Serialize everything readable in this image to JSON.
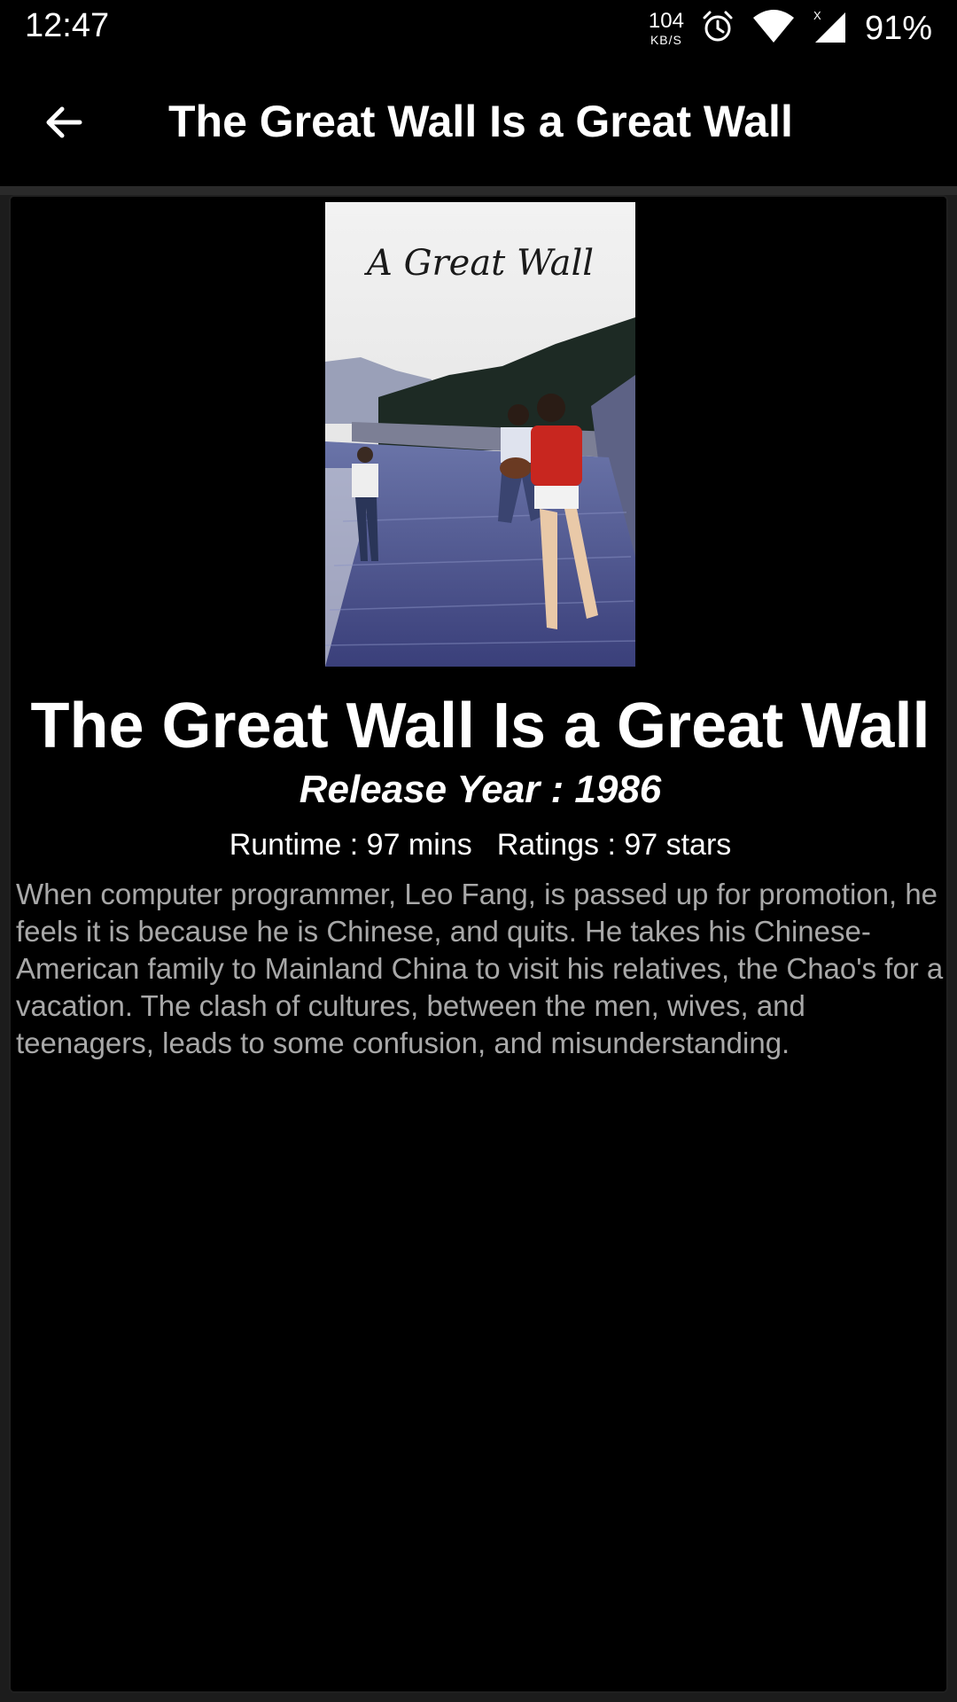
{
  "status_bar": {
    "time": "12:47",
    "net_speed_value": "104",
    "net_speed_unit": "KB/S",
    "battery": "91%"
  },
  "app_bar": {
    "title": "The Great Wall Is a Great Wall",
    "back_icon": "arrow-back-icon"
  },
  "movie": {
    "poster_text": "A Great Wall",
    "title": "The Great Wall Is a Great Wall",
    "release_year": "Release Year : 1986",
    "runtime": "Runtime : 97 mins",
    "ratings": "Ratings : 97 stars",
    "overview": "When computer programmer, Leo Fang, is passed up for promotion, he feels it is because he is Chinese, and quits. He takes his Chinese-American family to Mainland China to visit his relatives, the Chao's for a vacation. The clash of cultures, between the men, wives, and teenagers, leads to some confusion, and misunderstanding."
  },
  "colors": {
    "background": "#000000",
    "text_primary": "#ffffff",
    "text_secondary": "#a8a8a8"
  }
}
